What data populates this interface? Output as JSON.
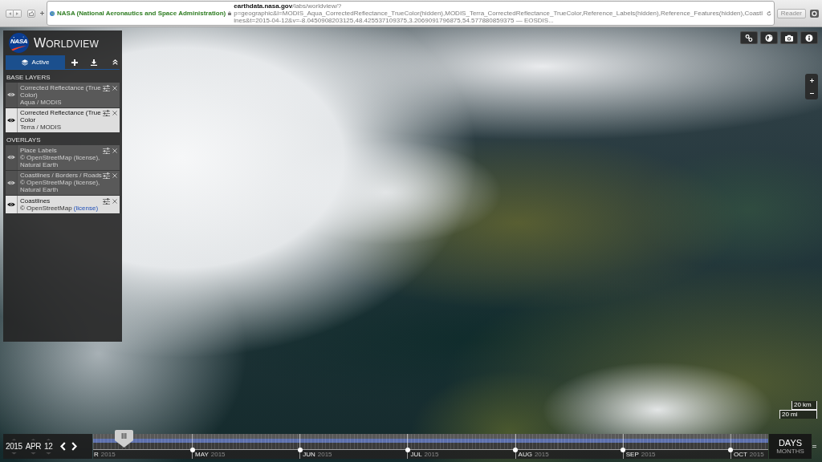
{
  "browser": {
    "site_identity": "NASA (National Aeronautics and Space Administration)",
    "url": "**earthdata.nasa.gov**/labs/worldview/?p=geographic&l=MODIS_Aqua_CorrectedReflectance_TrueColor(hidden),MODIS_Terra_CorrectedReflectance_TrueColor,Reference_Labels(hidden),Reference_Features(hidden),Coastlines&t=2015-04-12&v=-8.0450908203125,48.425537109375,3.2069091796875,54.577880859375 — EOSDIS...",
    "reader_button": "Reader"
  },
  "sidebar": {
    "logo_text": "NASA",
    "title": "WORLDVIEW",
    "tabs": [
      {
        "kind": "layers",
        "label": "Active",
        "selected": true
      },
      {
        "kind": "add",
        "selected": false
      },
      {
        "kind": "download",
        "selected": false
      }
    ],
    "sections": [
      {
        "title": "BASE LAYERS",
        "layers": [
          {
            "name": "Corrected Reflectance (True Color)",
            "source": "Aqua / MODIS",
            "visible": false
          },
          {
            "name": "Corrected Reflectance (True Color",
            "source": "Terra / MODIS",
            "visible": true
          }
        ]
      },
      {
        "title": "OVERLAYS",
        "layers": [
          {
            "name": "Place Labels",
            "source": "© OpenStreetMap",
            "link": "(license)",
            "source_end": ", Natural Earth",
            "visible": false
          },
          {
            "name": "Coastlines / Borders / Roads",
            "source": "© OpenStreetMap",
            "link": "(license)",
            "source_end": ", Natural Earth",
            "visible": false
          },
          {
            "name": "Coastlines",
            "source": "© OpenStreetMap",
            "link": "(license)",
            "visible": true
          }
        ]
      }
    ]
  },
  "map": {
    "scale": [
      "20 km",
      "20 mi"
    ]
  },
  "timeline": {
    "date": {
      "year": "2015",
      "month": "APR",
      "day": "12"
    },
    "level": 0.046,
    "months": [
      {
        "name": "R",
        "year": "2015"
      },
      {
        "name": "MAY",
        "year": "2015"
      },
      {
        "name": "JUN",
        "year": "2015"
      },
      {
        "name": "JUL",
        "year": "2015"
      },
      {
        "name": "AUG",
        "year": "2015"
      },
      {
        "name": "SEP",
        "year": "2015"
      },
      {
        "name": "OCT",
        "year": "2015"
      }
    ],
    "zoom_levels": [
      {
        "label": "DAYS",
        "selected": true
      },
      {
        "label": "MONTHS",
        "selected": false
      }
    ]
  }
}
